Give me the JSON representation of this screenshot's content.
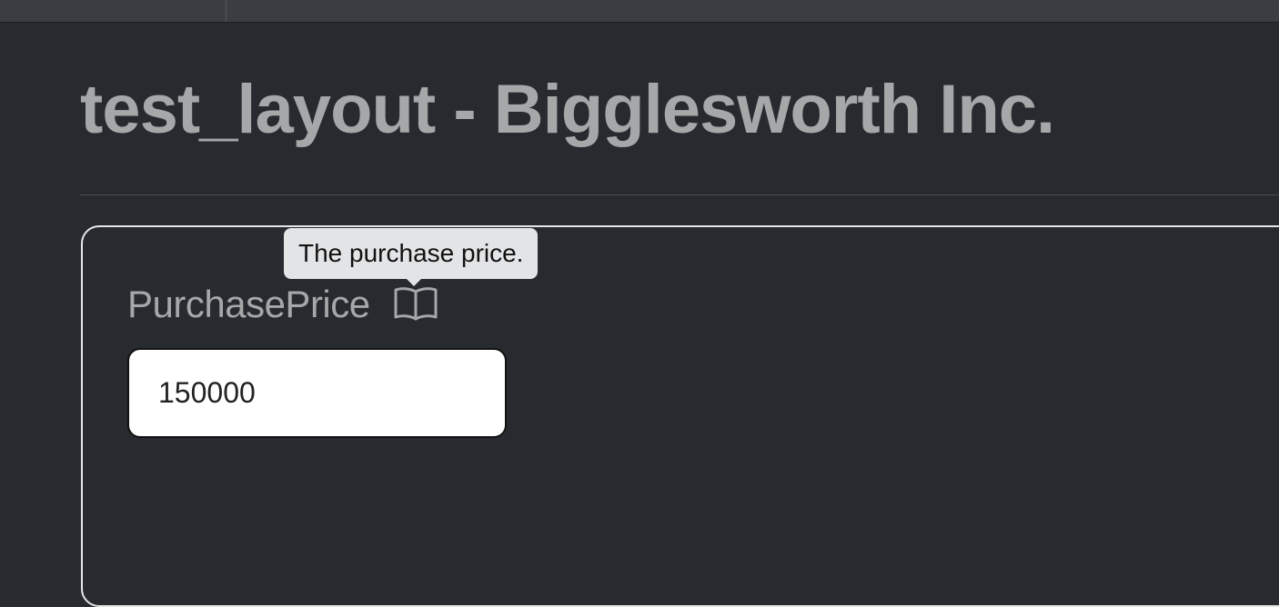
{
  "page": {
    "title": "test_layout - Bigglesworth Inc."
  },
  "form": {
    "field_label": "PurchasePrice",
    "help_icon": "book-icon",
    "tooltip": "The purchase price.",
    "input_value": "150000"
  },
  "colors": {
    "background": "#272a2f",
    "title_text": "#a6a7a9",
    "card_border": "#e6e7e8",
    "tooltip_bg": "#e3e4e6",
    "input_bg": "#ffffff"
  }
}
